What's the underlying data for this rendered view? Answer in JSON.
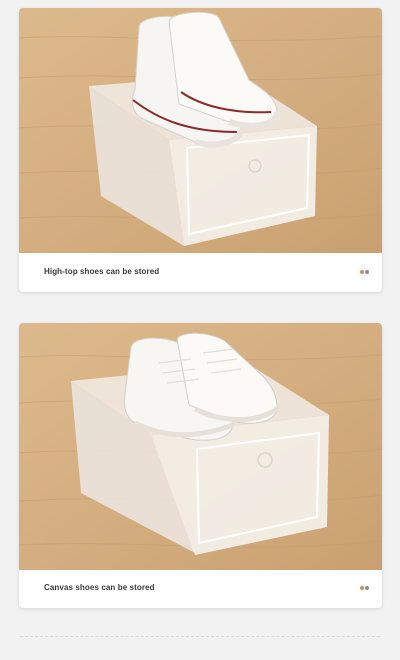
{
  "items": [
    {
      "caption": "High-top shoes can be stored"
    },
    {
      "caption": "Canvas shoes can be stored"
    }
  ],
  "colors": {
    "page_bg": "#f2f2f2",
    "wood": "#d8b487",
    "dot_accent": "#c98f63",
    "dot_secondary": "#8f8f8f"
  },
  "icons": [
    "pager-dots",
    "pager-dots"
  ]
}
